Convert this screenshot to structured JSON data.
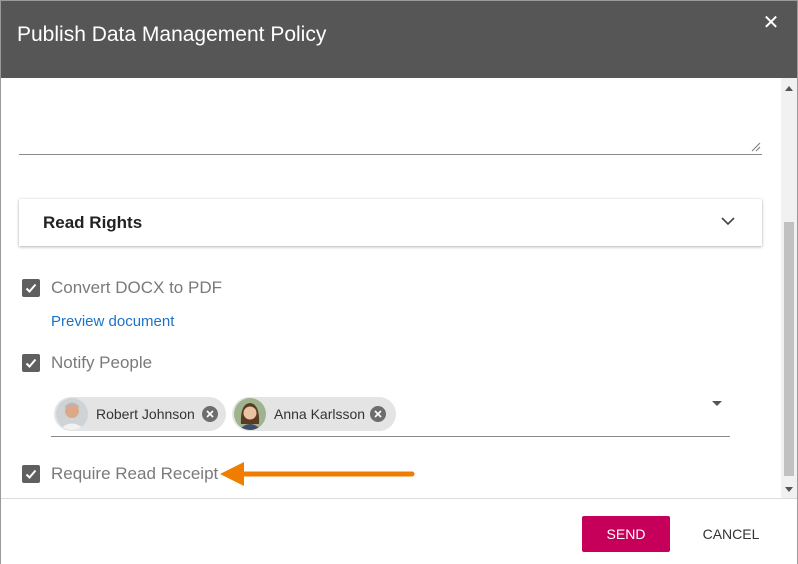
{
  "dialog": {
    "title": "Publish Data Management Policy",
    "close_icon": "close-icon",
    "close_glyph": "✕"
  },
  "read_rights": {
    "label": "Read Rights",
    "expanded": false,
    "icon": "chevron-down-icon"
  },
  "options": {
    "convert_pdf": {
      "label": "Convert DOCX to PDF",
      "checked": true
    },
    "preview_link": "Preview document",
    "notify_people": {
      "label": "Notify People",
      "checked": true
    },
    "require_receipt": {
      "label": "Require Read Receipt",
      "checked": true
    }
  },
  "recipients": [
    {
      "name": "Robert Johnson"
    },
    {
      "name": "Anna Karlsson"
    }
  ],
  "footer": {
    "send_label": "SEND",
    "cancel_label": "CANCEL"
  },
  "colors": {
    "titlebar": "#565656",
    "send_button": "#c6005a",
    "link": "#1a73c8",
    "annotation_arrow": "#f07d00",
    "checkbox": "#5f5f5f"
  }
}
